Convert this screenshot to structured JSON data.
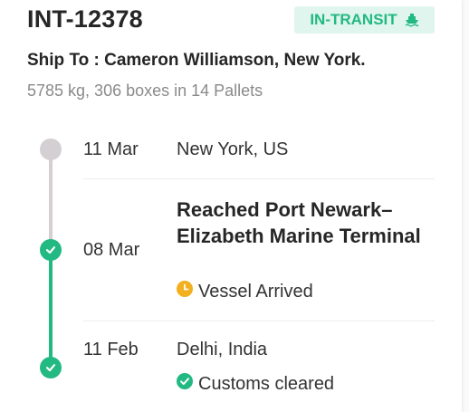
{
  "header": {
    "shipment_id": "INT-12378",
    "status": "IN-TRANSIT",
    "status_icon": "ship-icon",
    "ship_to": "Ship To : Cameron Williamson, New York.",
    "summary": "5785 kg, 306 boxes in 14 Pallets"
  },
  "timeline": [
    {
      "date": "11 Mar",
      "location": "New York, US",
      "state": "pending"
    },
    {
      "date": "08 Mar",
      "title": "Reached Port Newark–Elizabeth Marine Terminal",
      "sub_icon": "clock-icon",
      "sub_label": "Vessel Arrived",
      "state": "done"
    },
    {
      "date": "11 Feb",
      "location": "Delhi, India",
      "sub_icon": "check-circle-icon",
      "sub_label": "Customs cleared",
      "state": "done"
    }
  ],
  "colors": {
    "green": "#22b982",
    "badge_bg": "#dff5ee",
    "pending_grey": "#d4cfd2",
    "clock_yellow": "#f2b01e"
  }
}
